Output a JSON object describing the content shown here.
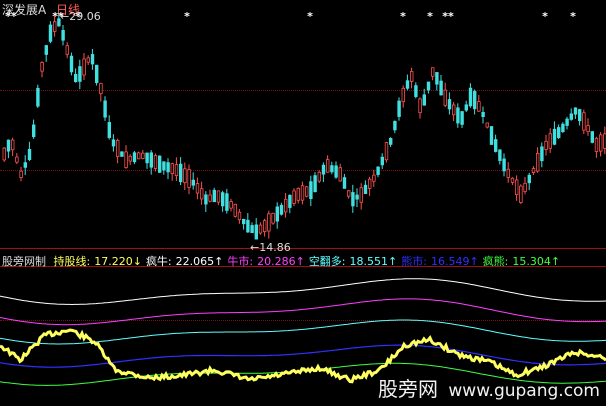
{
  "header": {
    "stock_name": "深发展A",
    "period": "日线"
  },
  "price_panel": {
    "high_label": "←29.06",
    "low_label": "←14.86",
    "signal_markers": [
      "**",
      "**",
      "*",
      "*",
      "*",
      "*",
      "*",
      "**",
      "*",
      "*"
    ]
  },
  "indicator": {
    "name": "股旁网制",
    "items": [
      {
        "label": "持股线:",
        "value": "17.220↓",
        "color": "#ffff60"
      },
      {
        "label": "疯牛:",
        "value": "22.065↑",
        "color": "#ffffff"
      },
      {
        "label": "牛市:",
        "value": "20.286↑",
        "color": "#ff40ff"
      },
      {
        "label": "空翻多:",
        "value": "18.551↑",
        "color": "#60ffff"
      },
      {
        "label": "熊市:",
        "value": "16.549↑",
        "color": "#3030ff"
      },
      {
        "label": "疯熊:",
        "value": "15.304↑",
        "color": "#40ff40"
      }
    ]
  },
  "watermark": {
    "brand": "股旁网",
    "url": "www.gupang.com"
  },
  "colors": {
    "up": "#ff5050",
    "down": "#40e0e0",
    "grid": "#7a1010",
    "background": "#000000"
  }
}
